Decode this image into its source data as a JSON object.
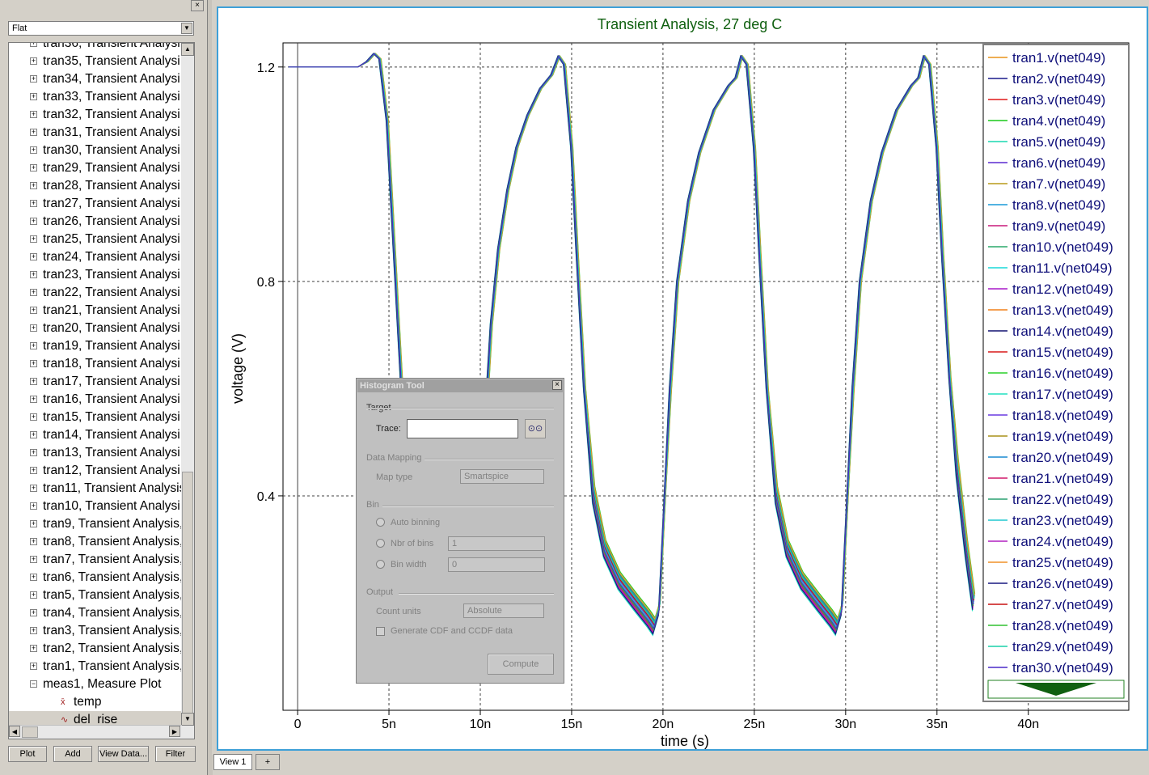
{
  "browser": {
    "view_mode": "Flat",
    "tree_top_partial": "tran36, Transient Analysi",
    "tree_items": [
      "tran35, Transient Analysi",
      "tran34, Transient Analysi",
      "tran33, Transient Analysi",
      "tran32, Transient Analysi",
      "tran31, Transient Analysi",
      "tran30, Transient Analysi",
      "tran29, Transient Analysi",
      "tran28, Transient Analysi",
      "tran27, Transient Analysi",
      "tran26, Transient Analysi",
      "tran25, Transient Analysi",
      "tran24, Transient Analysi",
      "tran23, Transient Analysi",
      "tran22, Transient Analysi",
      "tran21, Transient Analysi",
      "tran20, Transient Analysi",
      "tran19, Transient Analysi",
      "tran18, Transient Analysi",
      "tran17, Transient Analysi",
      "tran16, Transient Analysi",
      "tran15, Transient Analysi",
      "tran14, Transient Analysi",
      "tran13, Transient Analysi",
      "tran12, Transient Analysi",
      "tran11, Transient Analysis",
      "tran10, Transient Analysi",
      "tran9, Transient Analysis,",
      "tran8, Transient Analysis,",
      "tran7, Transient Analysis,",
      "tran6, Transient Analysis,",
      "tran5, Transient Analysis,",
      "tran4, Transient Analysis,",
      "tran3, Transient Analysis,",
      "tran2, Transient Analysis,",
      "tran1, Transient Analysis,"
    ],
    "meas_item": "meas1, Measure Plot",
    "meas_children": [
      "temp",
      "del_rise"
    ],
    "buttons": {
      "plot": "Plot",
      "add": "Add",
      "view_data": "View Data...",
      "filter": "Filter"
    }
  },
  "tabs": {
    "view1": "View 1",
    "add": "+"
  },
  "histogram_tool": {
    "title": "Histogram Tool",
    "target_group": "Target",
    "trace_label": "Trace:",
    "trace_value": "",
    "data_mapping_group": "Data Mapping",
    "map_type_label": "Map type",
    "map_type_value": "Smartspice",
    "bin_group": "Bin",
    "auto_binning_label": "Auto binning",
    "nbr_bins_label": "Nbr of bins",
    "nbr_bins_value": "1",
    "bin_width_label": "Bin width",
    "bin_width_value": "0",
    "output_group": "Output",
    "count_units_label": "Count units",
    "count_units_value": "Absolute",
    "cdf_label": "Generate CDF and CCDF data",
    "compute_label": "Compute"
  },
  "chart_data": {
    "type": "line",
    "title": "Transient Analysis, 27 deg C",
    "xlabel": "time (s)",
    "ylabel": "voltage (V)",
    "xlim": [
      -0.8,
      45.5
    ],
    "ylim": [
      0.0,
      1.245
    ],
    "x_ticks": [
      0,
      5,
      10,
      15,
      20,
      25,
      30,
      35,
      40
    ],
    "x_tick_labels": [
      "0",
      "5n",
      "10n",
      "15n",
      "20n",
      "25n",
      "30n",
      "35n",
      "40n"
    ],
    "y_ticks": [
      0.4,
      0.8,
      1.2
    ],
    "y_tick_labels": [
      "0.4",
      "0.8",
      "1.2"
    ],
    "grid": true,
    "legend_placement": "right",
    "series": [
      {
        "name": "tran1.v(net049)",
        "color": "#e8941a",
        "offset": 0.0
      },
      {
        "name": "tran2.v(net049)",
        "color": "#1a1a8c",
        "offset": 0.02
      },
      {
        "name": "tran3.v(net049)",
        "color": "#e01818",
        "offset": -0.02
      },
      {
        "name": "tran4.v(net049)",
        "color": "#18c818",
        "offset": 0.04
      },
      {
        "name": "tran5.v(net049)",
        "color": "#18d8b0",
        "offset": 0.01
      },
      {
        "name": "tran6.v(net049)",
        "color": "#5a2ad0",
        "offset": -0.03
      },
      {
        "name": "tran7.v(net049)",
        "color": "#b89a18",
        "offset": 0.03
      },
      {
        "name": "tran8.v(net049)",
        "color": "#189ad8",
        "offset": -0.01
      },
      {
        "name": "tran9.v(net049)",
        "color": "#c8187a",
        "offset": 0.05
      },
      {
        "name": "tran10.v(net049)",
        "color": "#2aa86a",
        "offset": -0.04
      },
      {
        "name": "tran11.v(net049)",
        "color": "#18d8d8",
        "offset": 0.06
      },
      {
        "name": "tran12.v(net049)",
        "color": "#a818c8",
        "offset": -0.05
      },
      {
        "name": "tran13.v(net049)",
        "color": "#f08018",
        "offset": 0.02
      },
      {
        "name": "tran14.v(net049)",
        "color": "#101070",
        "offset": -0.02
      },
      {
        "name": "tran15.v(net049)",
        "color": "#d81818",
        "offset": 0.03
      },
      {
        "name": "tran16.v(net049)",
        "color": "#28d028",
        "offset": 0.07
      },
      {
        "name": "tran17.v(net049)",
        "color": "#20e0c0",
        "offset": -0.06
      },
      {
        "name": "tran18.v(net049)",
        "color": "#6a3ae0",
        "offset": 0.01
      },
      {
        "name": "tran19.v(net049)",
        "color": "#a89018",
        "offset": -0.01
      },
      {
        "name": "tran20.v(net049)",
        "color": "#1a8ad0",
        "offset": 0.04
      },
      {
        "name": "tran21.v(net049)",
        "color": "#d0186a",
        "offset": -0.03
      },
      {
        "name": "tran22.v(net049)",
        "color": "#2aa070",
        "offset": 0.05
      },
      {
        "name": "tran23.v(net049)",
        "color": "#20c8d0",
        "offset": 0.0
      },
      {
        "name": "tran24.v(net049)",
        "color": "#b020c0",
        "offset": -0.04
      },
      {
        "name": "tran25.v(net049)",
        "color": "#f09028",
        "offset": 0.06
      },
      {
        "name": "tran26.v(net049)",
        "color": "#181880",
        "offset": -0.05
      },
      {
        "name": "tran27.v(net049)",
        "color": "#c81010",
        "offset": 0.02
      },
      {
        "name": "tran28.v(net049)",
        "color": "#30c030",
        "offset": -0.02
      },
      {
        "name": "tran29.v(net049)",
        "color": "#18d0a8",
        "offset": 0.03
      },
      {
        "name": "tran30.v(net049)",
        "color": "#4a2ac8",
        "offset": -0.01
      }
    ],
    "waveform_points": [
      [
        -0.5,
        1.2
      ],
      [
        3.3,
        1.2
      ],
      [
        3.8,
        1.21
      ],
      [
        4.2,
        1.225
      ],
      [
        4.5,
        1.215
      ],
      [
        4.9,
        1.1
      ],
      [
        5.3,
        0.85
      ],
      [
        5.7,
        0.6
      ],
      [
        6.0,
        0.45
      ],
      [
        6.3,
        0.38
      ],
      [
        6.6,
        0.33
      ],
      [
        7.2,
        0.27
      ],
      [
        8.0,
        0.21
      ],
      [
        8.8,
        0.17
      ],
      [
        9.3,
        0.15
      ],
      [
        9.7,
        0.17
      ],
      [
        10.0,
        0.3
      ],
      [
        10.3,
        0.55
      ],
      [
        10.6,
        0.72
      ],
      [
        11.0,
        0.86
      ],
      [
        11.5,
        0.97
      ],
      [
        12.0,
        1.05
      ],
      [
        12.6,
        1.11
      ],
      [
        13.3,
        1.16
      ],
      [
        13.9,
        1.185
      ],
      [
        14.3,
        1.22
      ],
      [
        14.6,
        1.205
      ],
      [
        15.0,
        1.05
      ],
      [
        15.3,
        0.85
      ],
      [
        15.7,
        0.6
      ],
      [
        16.2,
        0.4
      ],
      [
        16.8,
        0.3
      ],
      [
        17.6,
        0.24
      ],
      [
        18.5,
        0.2
      ],
      [
        19.2,
        0.17
      ],
      [
        19.5,
        0.155
      ],
      [
        19.8,
        0.19
      ],
      [
        20.1,
        0.4
      ],
      [
        20.4,
        0.6
      ],
      [
        20.8,
        0.8
      ],
      [
        21.4,
        0.95
      ],
      [
        22.0,
        1.04
      ],
      [
        22.8,
        1.12
      ],
      [
        23.6,
        1.165
      ],
      [
        24.0,
        1.18
      ],
      [
        24.3,
        1.22
      ],
      [
        24.6,
        1.205
      ],
      [
        25.0,
        1.05
      ],
      [
        25.3,
        0.85
      ],
      [
        25.7,
        0.6
      ],
      [
        26.2,
        0.4
      ],
      [
        26.8,
        0.3
      ],
      [
        27.6,
        0.24
      ],
      [
        28.5,
        0.2
      ],
      [
        29.2,
        0.17
      ],
      [
        29.5,
        0.155
      ],
      [
        29.8,
        0.19
      ],
      [
        30.1,
        0.4
      ],
      [
        30.4,
        0.6
      ],
      [
        30.8,
        0.8
      ],
      [
        31.4,
        0.95
      ],
      [
        32.0,
        1.04
      ],
      [
        32.8,
        1.12
      ],
      [
        33.6,
        1.165
      ],
      [
        34.0,
        1.18
      ],
      [
        34.3,
        1.22
      ],
      [
        34.6,
        1.205
      ],
      [
        35.0,
        1.05
      ],
      [
        35.3,
        0.85
      ],
      [
        35.7,
        0.62
      ],
      [
        36.1,
        0.45
      ],
      [
        36.6,
        0.3
      ],
      [
        37.0,
        0.2
      ]
    ]
  }
}
